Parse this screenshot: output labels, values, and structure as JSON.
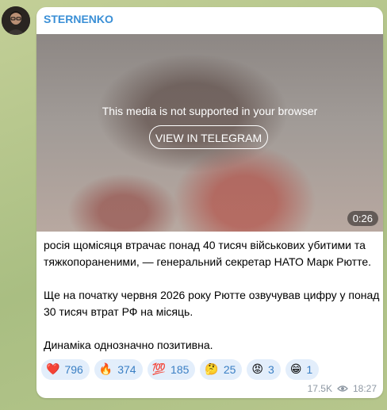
{
  "channel": {
    "name": "STERNENKO"
  },
  "media": {
    "notice": "This media is not supported in your browser",
    "button_label": "VIEW IN TELEGRAM",
    "duration": "0:26"
  },
  "message": {
    "paragraphs": [
      "росія щомісяця втрачає понад 40 тисяч військових убитими та тяжкопораненими, — генеральний секретар НАТО Марк Рютте.",
      "Ще на початку червня 2026 року Рютте озвучував цифру у понад 30 тисяч втрат РФ на місяць.",
      "Динаміка однозначно позитивна."
    ]
  },
  "reactions": [
    {
      "emoji": "❤️",
      "icon": "red-heart-icon",
      "count": "796"
    },
    {
      "emoji": "🔥",
      "icon": "fire-icon",
      "count": "374"
    },
    {
      "emoji": "💯",
      "icon": "hundred-points-icon",
      "count": "185"
    },
    {
      "emoji": "🤔",
      "icon": "thinking-face-icon",
      "count": "25"
    },
    {
      "emoji": "😡",
      "icon": "angry-face-icon",
      "count": "3"
    },
    {
      "emoji": "😁",
      "icon": "grinning-face-icon",
      "count": "1"
    }
  ],
  "meta": {
    "views": "17.5K",
    "time": "18:27"
  },
  "colors": {
    "accent": "#3a8fd6",
    "reaction_bg": "#e3eefb",
    "chat_bg": "#b9c98f"
  }
}
